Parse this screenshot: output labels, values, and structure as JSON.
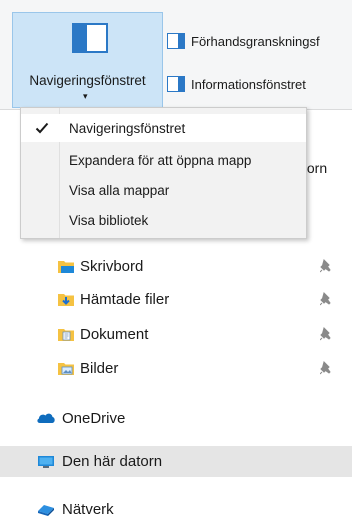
{
  "ribbon": {
    "nav_pane_label": "Navigeringsfönstret",
    "nav_pane_arrow": "▾",
    "preview_pane_label": "Förhandsgranskningsf",
    "details_pane_label": "Informationsfönstret"
  },
  "address_fragment": "torn",
  "dropdown": {
    "items": [
      {
        "label": "Navigeringsfönstret",
        "checked": true
      },
      {
        "label": "Expandera för att öppna mapp",
        "checked": false
      },
      {
        "label": "Visa alla mappar",
        "checked": false
      },
      {
        "label": "Visa bibliotek",
        "checked": false
      }
    ]
  },
  "quick_access": [
    {
      "label": "Skrivbord",
      "icon": "desktop-folder-icon",
      "pinned": true
    },
    {
      "label": "Hämtade filer",
      "icon": "downloads-folder-icon",
      "pinned": true
    },
    {
      "label": "Dokument",
      "icon": "documents-folder-icon",
      "pinned": true
    },
    {
      "label": "Bilder",
      "icon": "pictures-folder-icon",
      "pinned": true
    }
  ],
  "tree": {
    "onedrive": "OneDrive",
    "this_pc": "Den här datorn",
    "network": "Nätverk"
  },
  "colors": {
    "accent": "#2b78c6",
    "selected_bg": "#e5e5e5",
    "button_pressed_bg": "#cce4f7",
    "folder_yellow": "#f5c242",
    "onedrive_blue": "#0f6cbd"
  }
}
